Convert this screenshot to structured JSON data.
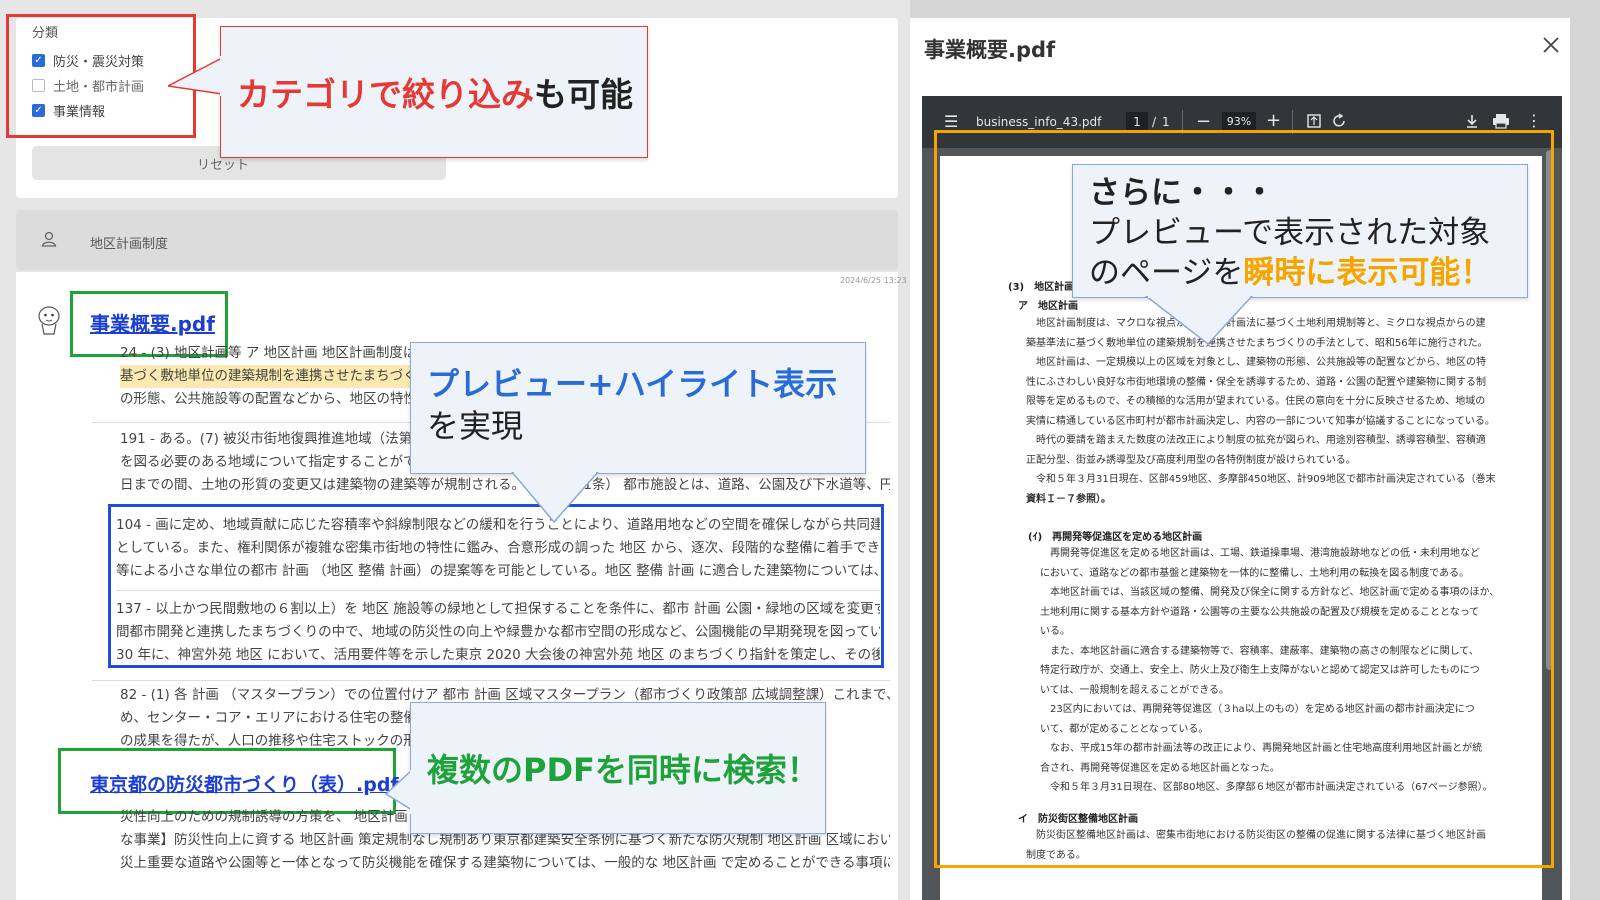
{
  "filter": {
    "heading": "分類",
    "options": [
      {
        "label": "防災・震災対策",
        "checked": true
      },
      {
        "label": "土地・都市計画",
        "checked": false
      },
      {
        "label": "事業情報",
        "checked": true
      }
    ],
    "reset_label": "リセット"
  },
  "callouts": {
    "category": {
      "highlight": "カテゴリで絞り込み",
      "rest": "も可能"
    },
    "preview": {
      "highlight": "プレビュー+ハイライト表示",
      "rest": "を実現"
    },
    "multi": {
      "text": "複数のPDFを同時に検索！"
    },
    "jump": {
      "line1": "さらに・・・",
      "line2": "プレビューで表示された対象",
      "line3_pre": "のページを",
      "line3_hl": "瞬時に表示可能！"
    }
  },
  "query": {
    "icon": "user-icon",
    "text": "地区計画制度"
  },
  "result": {
    "timestamp": "2024/6/25 13:23",
    "file1": "事業概要.pdf",
    "file2": "東京都の防災都市づくり（表）.pdf",
    "snippets": [
      {
        "lines": [
          "24 - (3) 地区計画等 ア 地区計画 地区計画制度は、マクロな視点からの都市計画法に",
          "基づく敷地単位の建築規制を連携させたまちづくりの手法として、建築物",
          "の形態、公共施設等の配置などから、地区の特性にふさわしい..."
        ]
      },
      {
        "lines": [
          "191 - ある。(7) 被災市街地復興推進地域（法第10条の2）大規模な災害を受けた地域で復興",
          "を図る必要のある地域について指定することができる。指定された",
          "日までの間、土地の形質の変更又は建築物の建築等が規制される。(8) ...（11条） 都市施設とは、道路、公園及び下水道等、円..."
        ]
      },
      {
        "lines": [
          "104 - 画に定め、地域貢献に応じた容積率や斜線制限などの緩和を行うことにより、道路用地などの空間を確保しながら共同建替え等を推進するこ",
          "としている。また、権利関係が複雑な密集市街地の特性に鑑み、合意形成の調った 地区 から、逐次、段階的な整備に着手できるよう、土地所有者",
          "等による小さな単位の都市 計画 （地区 整備 計画）の提案等を可能としている。地区 整備 計画 に適合した建築物については、東京都建築安..."
        ]
      },
      {
        "lines": [
          "137 - 以上かつ民間敷地の６割以上）を 地区 施設等の緑地として担保することを条件に、都市 計画 公園・緑地の区域を変更する 制度 であり、民",
          "間都市開発と連携したまちづくりの中で、地域の防災性の向上や緑豊かな都市空間の形成など、公園機能の早期発現を図っていくものである。平成",
          "30 年に、神宮外苑 地区 において、活用要件等を示した東京 2020 大会後の神宮外苑 地区 のまちづくり指針を策定し、その後、民間事業者から..."
        ]
      },
      {
        "lines": [
          "82 - (1) 各 計画 （マスタープラン）での位置付けア 都市 計画 区域マスタープラン（都市づくり政策部 広域調整課）これまで、防災性の向上などを図るた",
          "め、センター・コア・エリアにおける住宅の整備に対して、特定の地区を指定して容積率を緩和するなど一定",
          "の成果を得たが、人口の推移や住宅ストックの形成状況... 的に確唯に..."
        ]
      },
      {
        "lines": [
          "災性向上のための規制誘導の方策を、 地区計画 を活用した規制誘導を行う制度であります。【主",
          "な事業】防災性向上に資する 地区計画 策定規制なし規制あり東京都建築安全条例に基づく新たな防火規制 地区計画 区域において、防",
          "災上重要な道路や公園等と一体となって防災機能を確保する建築物については、一般的な 地区計画 で定めることができる事項に加え、建築物の..."
        ]
      }
    ]
  },
  "viewer": {
    "title": "事業概要.pdf",
    "toolbar": {
      "filename": "business_info_43.pdf",
      "page": "1",
      "total": "1",
      "zoom": "93%"
    },
    "doc": {
      "h1": "(3)　地区計画",
      "h2": "ア　地区計画",
      "para1": [
        "地区計画制度は、マクロな視点からの都市計画法に基づく土地利用規制等と、ミクロな視点からの建",
        "築基準法に基づく敷地単位の建築規制を連携させたまちづくりの手法として、昭和56年に施行された。",
        "地区計画は、一定規模以上の区域を対象とし、建築物の形態、公共施設等の配置などから、地区の特",
        "性にふさわしい良好な市街地環境の整備・保全を誘導するため、道路・公園の配置や建築物に関する制",
        "限等を定めるもので、その積極的な活用が望まれている。住民の意向を十分に反映させるため、地域の",
        "実情に精通している区市町村が都市計画決定し、内容の一部について知事が協議することになっている。",
        "時代の要請を踏まえた数度の法改正により制度の拡充が図られ、用途別容積型、誘導容積型、容積適",
        "正配分型、街並み誘導型及び高度利用型の各特例制度が設けられている。",
        "令和５年３月31日現在、区部459地区、多摩部450地区、計909地区で都市計画決定されている（巻末",
        "資料Ｉ－７参照）。"
      ],
      "h3": "(ｲ)　再開発等促進区を定める地区計画",
      "para2": [
        "再開発等促進区を定める地区計画は、工場、鉄道操車場、港湾施設跡地などの低・未利用地など",
        "において、道路などの都市基盤と建築物を一体的に整備し、土地利用の転換を図る制度である。",
        "本地区計画では、当該区域の整備、開発及び保全に関する方針など、地区計画で定める事項のほか、",
        "土地利用に関する基本方針や道路・公園等の主要な公共施設の配置及び規模を定めることとなって",
        "いる。",
        "また、本地区計画に適合する建築物等で、容積率、建蔽率、建築物の高さの制限などに関して、",
        "特定行政庁が、交通上、安全上、防火上及び衛生上支障がないと認めて認定又は許可したものにつ",
        "いては、一般規制を超えることができる。",
        "23区内においては、再開発等促進区（３ha以上のもの）を定める地区計画の都市計画決定につ",
        "いて、都が定めることとなっている。",
        "なお、平成15年の都市計画法等の改正により、再開発地区計画と住宅地高度利用地区計画とが統",
        "合され、再開発等促進区を定める地区計画となった。",
        "令和５年３月31日現在、区部80地区、多摩部６地区が都市計画決定されている（67ページ参照）。"
      ],
      "h4": "イ　防災街区整備地区計画",
      "para3": [
        "防災街区整備地区計画は、密集市街地における防災街区の整備の促進に関する法律に基づく地区計画",
        "制度である。"
      ]
    }
  },
  "colors": {
    "red": "#e53935",
    "green": "#1fa23a",
    "blue": "#1f4fd8",
    "orange": "#f5a400",
    "callout_bg": "#eef3fa",
    "highlight_bg": "#fbe9b0"
  }
}
